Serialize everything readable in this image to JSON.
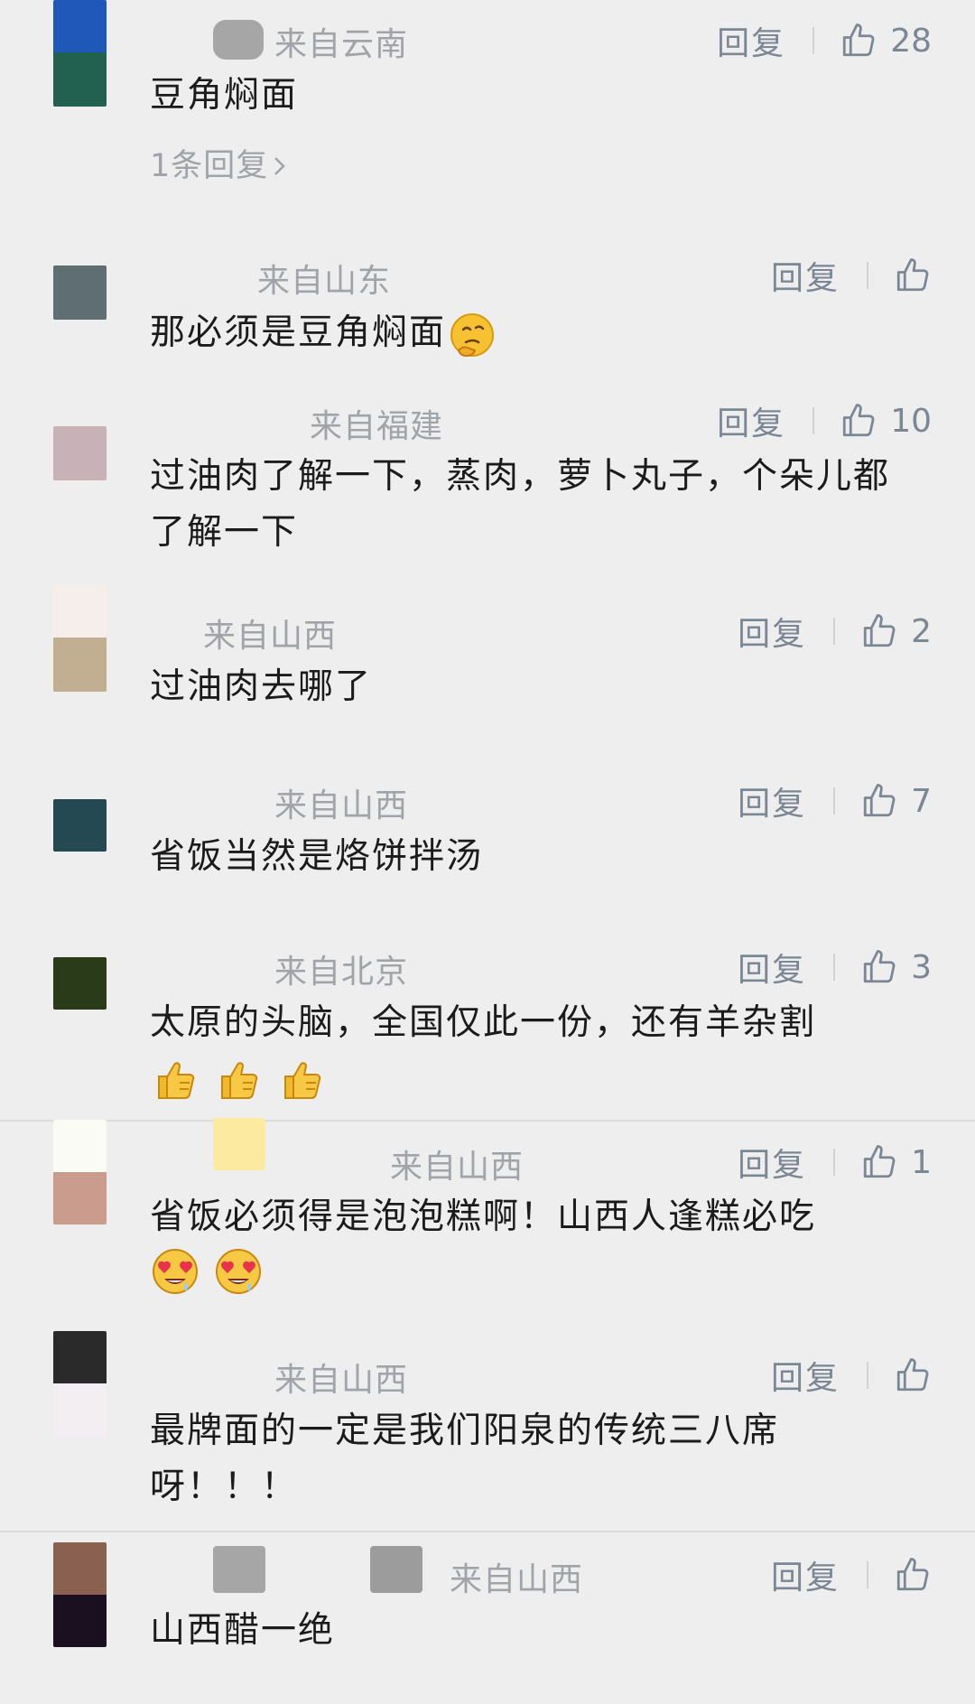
{
  "colors": {
    "background": "#eeeeef",
    "meta_text": "#a0a4a8",
    "action_text": "#7b8794",
    "comment_text": "#1b1b1b"
  },
  "icons": {
    "like": "thumbs-up-outline-icon",
    "chevron": "chevron-right-icon"
  },
  "reply_label": "回复",
  "comments": [
    {
      "location": "来自云南",
      "likes": "28",
      "text": "豆角焖面",
      "sub_replies": "1条回复",
      "avatar_colors": [
        "#1f58b8",
        "#22604f"
      ]
    },
    {
      "location": "来自山东",
      "likes": "",
      "text": "那必须是豆角焖面",
      "emoji": "thinking-face",
      "avatar_colors": [
        "#5f6e73"
      ]
    },
    {
      "location": "来自福建",
      "likes": "10",
      "text": "过油肉了解一下，蒸肉，萝卜丸子，个朵儿都了解一下",
      "avatar_colors": [
        "#c8b2b8"
      ]
    },
    {
      "location": "来自山西",
      "likes": "2",
      "text": "过油肉去哪了",
      "avatar_colors": [
        "#f6eeea",
        "#c2af92"
      ]
    },
    {
      "location": "来自山西",
      "likes": "7",
      "text": "省饭当然是烙饼拌汤",
      "avatar_colors": [
        "#244953"
      ]
    },
    {
      "location": "来自北京",
      "likes": "3",
      "text": "太原的头脑，全国仅此一份，还有羊杂割",
      "emoji": "thumbs-up x3",
      "avatar_colors": [
        "#2a3b1a"
      ]
    },
    {
      "location": "来自山西",
      "likes": "1",
      "text": "省饭必须得是泡泡糕啊！山西人逢糕必吃",
      "emoji": "heart-eyes x2",
      "avatar_colors": [
        "#fbfbf5",
        "#c99c8d"
      ]
    },
    {
      "location": "来自山西",
      "likes": "",
      "text": "最牌面的一定是我们阳泉的传统三八席呀！！！",
      "avatar_colors": [
        "#2a2a2a",
        "#f2eef1"
      ]
    },
    {
      "location": "来自山西",
      "likes": "",
      "text": "山西醋一绝",
      "avatar_colors": [
        "#8a6050",
        "#1a1020"
      ]
    }
  ]
}
